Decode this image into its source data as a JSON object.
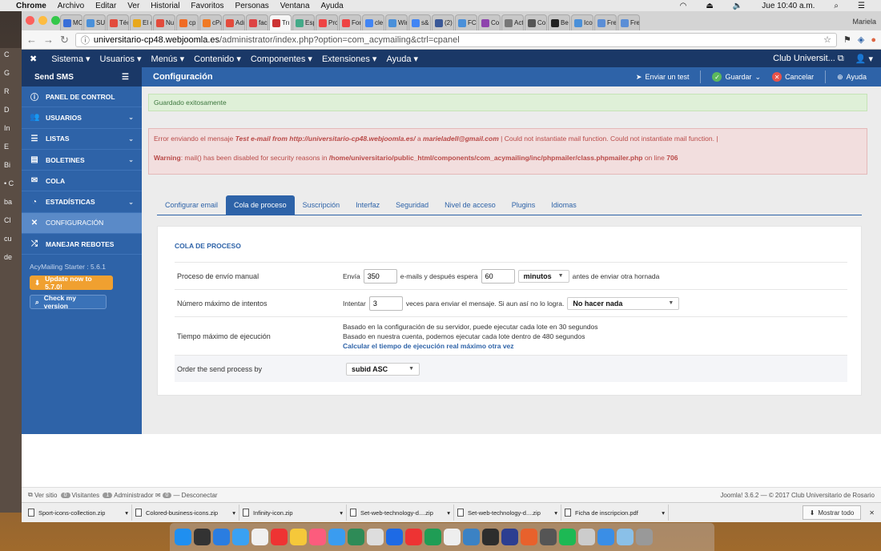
{
  "mac": {
    "menu": [
      "Chrome",
      "Archivo",
      "Editar",
      "Ver",
      "Historial",
      "Favoritos",
      "Personas",
      "Ventana",
      "Ayuda"
    ],
    "time": "Jue 10:40 a.m.",
    "profile": "Mariela"
  },
  "browser": {
    "tabs": [
      "MC",
      "SU",
      "Téc",
      "El c",
      "Nu",
      "cp",
      "cPa",
      "Adı",
      "fac",
      "Trı",
      "Esp",
      "Pro",
      "For",
      "cle",
      "Wir",
      "s&",
      "(2)",
      "FC",
      "Co",
      "Act",
      "Co",
      "Be",
      "Ico",
      "Fre",
      "Fre"
    ],
    "url_host": "universitario-cp48.webjoomla.es",
    "url_path": "/administrator/index.php?option=com_acymailing&ctrl=cpanel"
  },
  "joomla": {
    "top_menu": [
      "Sistema ▾",
      "Usuarios ▾",
      "Menús ▾",
      "Contenido ▾",
      "Componentes ▾",
      "Extensiones ▾",
      "Ayuda ▾"
    ],
    "site_name": "Club Universit... ⧉",
    "user_icon": "👤 ▾",
    "send_sms": "Send SMS",
    "page_title": "Configuración",
    "toolbar": {
      "test": "Enviar un test",
      "save": "Guardar",
      "cancel": "Cancelar",
      "help": "Ayuda"
    }
  },
  "sidebar": {
    "items": [
      {
        "label": "PANEL DE CONTROL",
        "icon": "ⓘ",
        "chev": ""
      },
      {
        "label": "USUARIOS",
        "icon": "👥",
        "chev": "⌄"
      },
      {
        "label": "LISTAS",
        "icon": "☰",
        "chev": "⌄"
      },
      {
        "label": "BOLETINES",
        "icon": "▤",
        "chev": "⌄"
      },
      {
        "label": "COLA",
        "icon": "✉",
        "chev": ""
      },
      {
        "label": "ESTADÍSTICAS",
        "icon": "◔",
        "chev": "⌄"
      },
      {
        "label": "CONFIGURACIÓN",
        "icon": "✕",
        "chev": ""
      },
      {
        "label": "MANEJAR REBOTES",
        "icon": "⤮",
        "chev": ""
      }
    ],
    "version": "AcyMailing Starter : 5.6.1",
    "update_btn": "Update now to 5.7.0!",
    "check_btn": "Check my version"
  },
  "alerts": {
    "success": "Guardado exitosamente",
    "err_1": "Error enviando el mensaje ",
    "err_2": "Test e-mail from http://universitario-cp48.webjoomla.es/",
    "err_3": " a ",
    "err_4": "marieladell@gmail.com",
    "err_5": " | Could not instantiate mail function. Could not instantiate mail function. |",
    "warn_1": "Warning",
    "warn_2": ": mail() has been disabled for security reasons in ",
    "warn_3": "/home/universitario/public_html/components/com_acymailing/inc/phpmailer/class.phpmailer.php",
    "warn_4": " on line ",
    "warn_5": "706"
  },
  "tabs": [
    "Configurar email",
    "Cola de proceso",
    "Suscripción",
    "Interfaz",
    "Seguridad",
    "Nivel de acceso",
    "Plugins",
    "Idiomas"
  ],
  "queue": {
    "heading": "COLA DE PROCESO",
    "r1_label": "Proceso de envío manual",
    "r1_a": "Envía",
    "r1_num": "350",
    "r1_b": "e-mails y después espera",
    "r1_wait": "60",
    "r1_unit": "minutos",
    "r1_c": "antes de enviar otra hornada",
    "r2_label": "Número máximo de intentos",
    "r2_a": "Intentar",
    "r2_num": "3",
    "r2_b": "veces para enviar el mensaje. Si aun así no lo logra.",
    "r2_sel": "No hacer nada",
    "r3_label": "Tiempo máximo de ejecución",
    "r3_l1": "Basado en la configuración de su servidor, puede ejecutar cada lote en 30 segundos",
    "r3_l2": "Basado en nuestra cuenta, podemos ejecutar cada lote dentro de 480 segundos",
    "r3_link": "Calcular el tiempo de ejecución real máximo otra vez",
    "r4_label": "Order the send process by",
    "r4_sel": "subid ASC"
  },
  "status": {
    "view": "Ver sitio",
    "visitors_n": "0",
    "visitors": "Visitantes",
    "admin_n": "1",
    "admin": "Administrador",
    "msg_n": "0",
    "logout": "Desconectar",
    "right": "Joomla! 3.6.2 — © 2017 Club Universitario de Rosario"
  },
  "downloads": [
    "Sport-icons-collection.zip",
    "Colored-business-icons.zip",
    "Infinity-icon.zip",
    "Set-web-technology-d....zip",
    "Set-web-technology-d....zip",
    "Ficha de inscripcion.pdf"
  ],
  "show_all": "Mostrar todo",
  "desk_left": [
    "C",
    "G",
    "R",
    "D",
    "In",
    "E",
    "Bi",
    "• C",
    "ba",
    "Cl",
    "cu",
    "de"
  ],
  "colors": {
    "joomla_dark": "#1a3867",
    "joomla_blue": "#2e63a8",
    "success": "#dff0d8",
    "error": "#f2dede"
  }
}
